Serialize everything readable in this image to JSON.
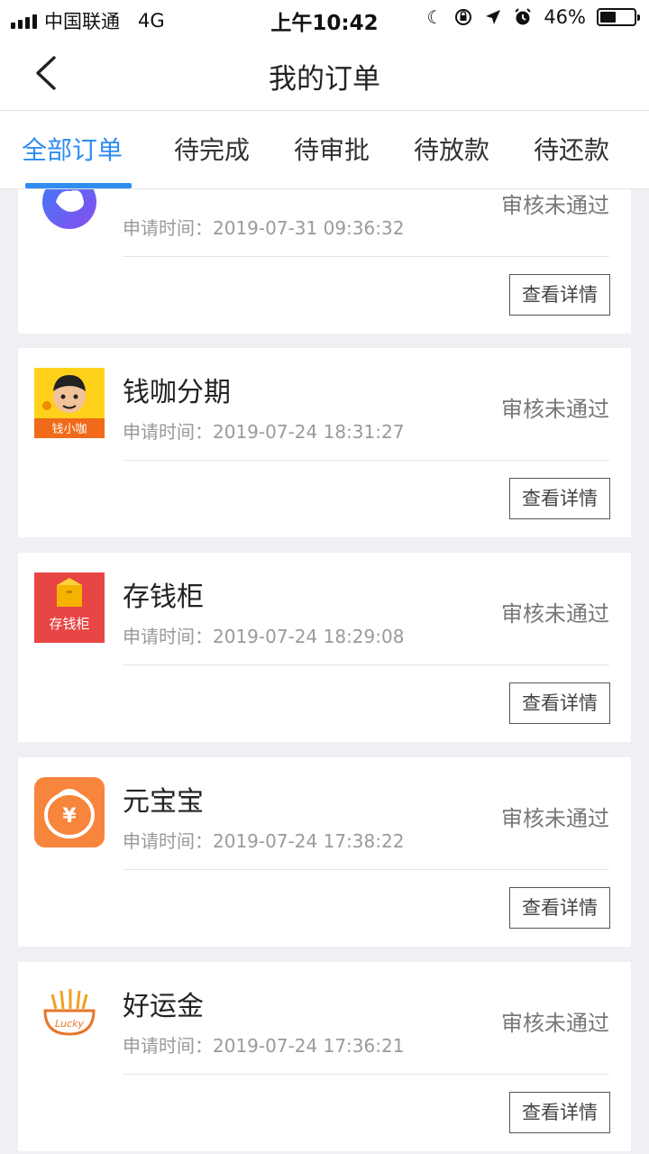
{
  "status_bar": {
    "carrier": "中国联通",
    "network": "4G",
    "time": "上午10:42",
    "battery": "46%",
    "battery_level": 0.46
  },
  "nav": {
    "title": "我的订单",
    "back_icon": "chevron-left-icon"
  },
  "tabs": [
    {
      "label": "全部订单",
      "active": true
    },
    {
      "label": "待完成",
      "active": false
    },
    {
      "label": "待审批",
      "active": false
    },
    {
      "label": "待放款",
      "active": false
    },
    {
      "label": "待还款",
      "active": false
    }
  ],
  "orders": [
    {
      "name": "",
      "apply_label": "申请时间：",
      "apply_time": "2019-07-31 09:36:32",
      "status": "审核未通过",
      "button": "查看详情",
      "logo": "blue-ring-logo-icon"
    },
    {
      "name": "钱咖分期",
      "apply_label": "申请时间：",
      "apply_time": "2019-07-24 18:31:27",
      "status": "审核未通过",
      "button": "查看详情",
      "logo": "qianxiaojia-logo-icon",
      "logo_text": "钱小咖"
    },
    {
      "name": "存钱柜",
      "apply_label": "申请时间：",
      "apply_time": "2019-07-24 18:29:08",
      "status": "审核未通过",
      "button": "查看详情",
      "logo": "cunqiangui-logo-icon",
      "logo_text": "存钱柜"
    },
    {
      "name": "元宝宝",
      "apply_label": "申请时间：",
      "apply_time": "2019-07-24 17:38:22",
      "status": "审核未通过",
      "button": "查看详情",
      "logo": "yuanbaobao-logo-icon",
      "logo_text": "¥"
    },
    {
      "name": "好运金",
      "apply_label": "申请时间：",
      "apply_time": "2019-07-24 17:36:21",
      "status": "审核未通过",
      "button": "查看详情",
      "logo": "haoyunjin-logo-icon",
      "logo_text": "Lucky"
    }
  ],
  "colors": {
    "accent": "#2f8cf0",
    "background": "#efeff4",
    "status_text": "#777777"
  }
}
